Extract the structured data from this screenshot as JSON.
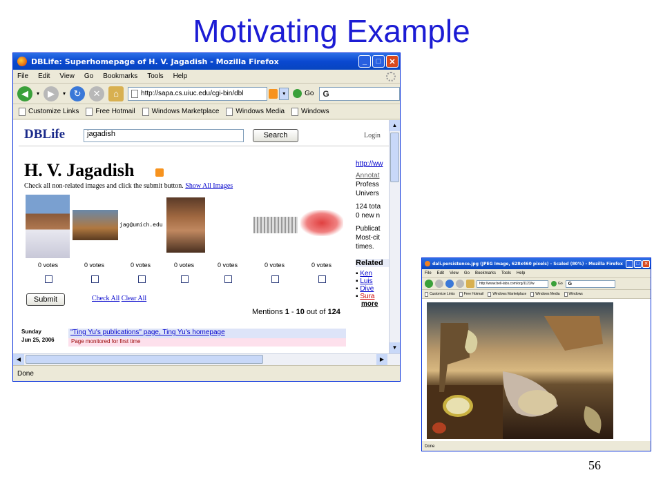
{
  "slide": {
    "title": "Motivating Example",
    "page_number": "56"
  },
  "main_window": {
    "title": "DBLife: Superhomepage of H. V. Jagadish - Mozilla Firefox",
    "menu": [
      "File",
      "Edit",
      "View",
      "Go",
      "Bookmarks",
      "Tools",
      "Help"
    ],
    "url": "http://sapa.cs.uiuc.edu/cgi-bin/dbl",
    "go_label": "Go",
    "bookmarks": [
      "Customize Links",
      "Free Hotmail",
      "Windows Marketplace",
      "Windows Media",
      "Windows"
    ],
    "status": "Done",
    "page": {
      "logo": "DBLife",
      "search_value": "jagadish",
      "search_button": "Search",
      "login": "Login",
      "person_name": "H. V. Jagadish",
      "instruction": "Check all non-related images and click the submit button.",
      "show_all_images": "Show All Images",
      "email_text": "jag@umich.edu",
      "votes": [
        "0 votes",
        "0 votes",
        "0 votes",
        "0 votes",
        "0 votes",
        "0 votes",
        "0 votes"
      ],
      "submit_label": "Submit",
      "check_all": "Check All",
      "clear_all": "Clear All",
      "mentions_prefix": "Mentions ",
      "mentions_from": "1",
      "mentions_sep": " - ",
      "mentions_to": "10",
      "mentions_of": " out of ",
      "mentions_total": "124",
      "date_day": "Sunday",
      "date_full": "Jun 25, 2006",
      "mention_link": "\"Ting Yu's publications\" page, Ting Yu's homepage",
      "monitored_text": "Page monitored for first time",
      "side": {
        "url_link": "http://ww",
        "annotate": "Annotat",
        "line1": "Profess",
        "line2": "Univers",
        "line3": "124 tota",
        "line4": "0 new n",
        "line5": "Publicat",
        "line6": "Most-cit",
        "line7": "times.",
        "related_heading": "Related",
        "related_items": [
          "Ken",
          "Luis",
          "Dive",
          "Sura"
        ],
        "more": "more"
      }
    }
  },
  "image_window": {
    "title": "dali.persistence.jpg (JPEG Image, 628x460 pixels) - Scaled (80%) - Mozilla Firefox",
    "menu": [
      "File",
      "Edit",
      "View",
      "Go",
      "Bookmarks",
      "Tools",
      "Help"
    ],
    "url": "http://www.bell-labs.com/org/1123/w",
    "go_label": "Go",
    "bookmarks": [
      "Customize Links",
      "Free Hotmail",
      "Windows Marketplace",
      "Windows Media",
      "Windows"
    ],
    "status": "Done"
  },
  "colors": {
    "slide_title": "#1c1cd4",
    "xp_titlebar": "#0a48d0",
    "link": "#0000cc"
  }
}
